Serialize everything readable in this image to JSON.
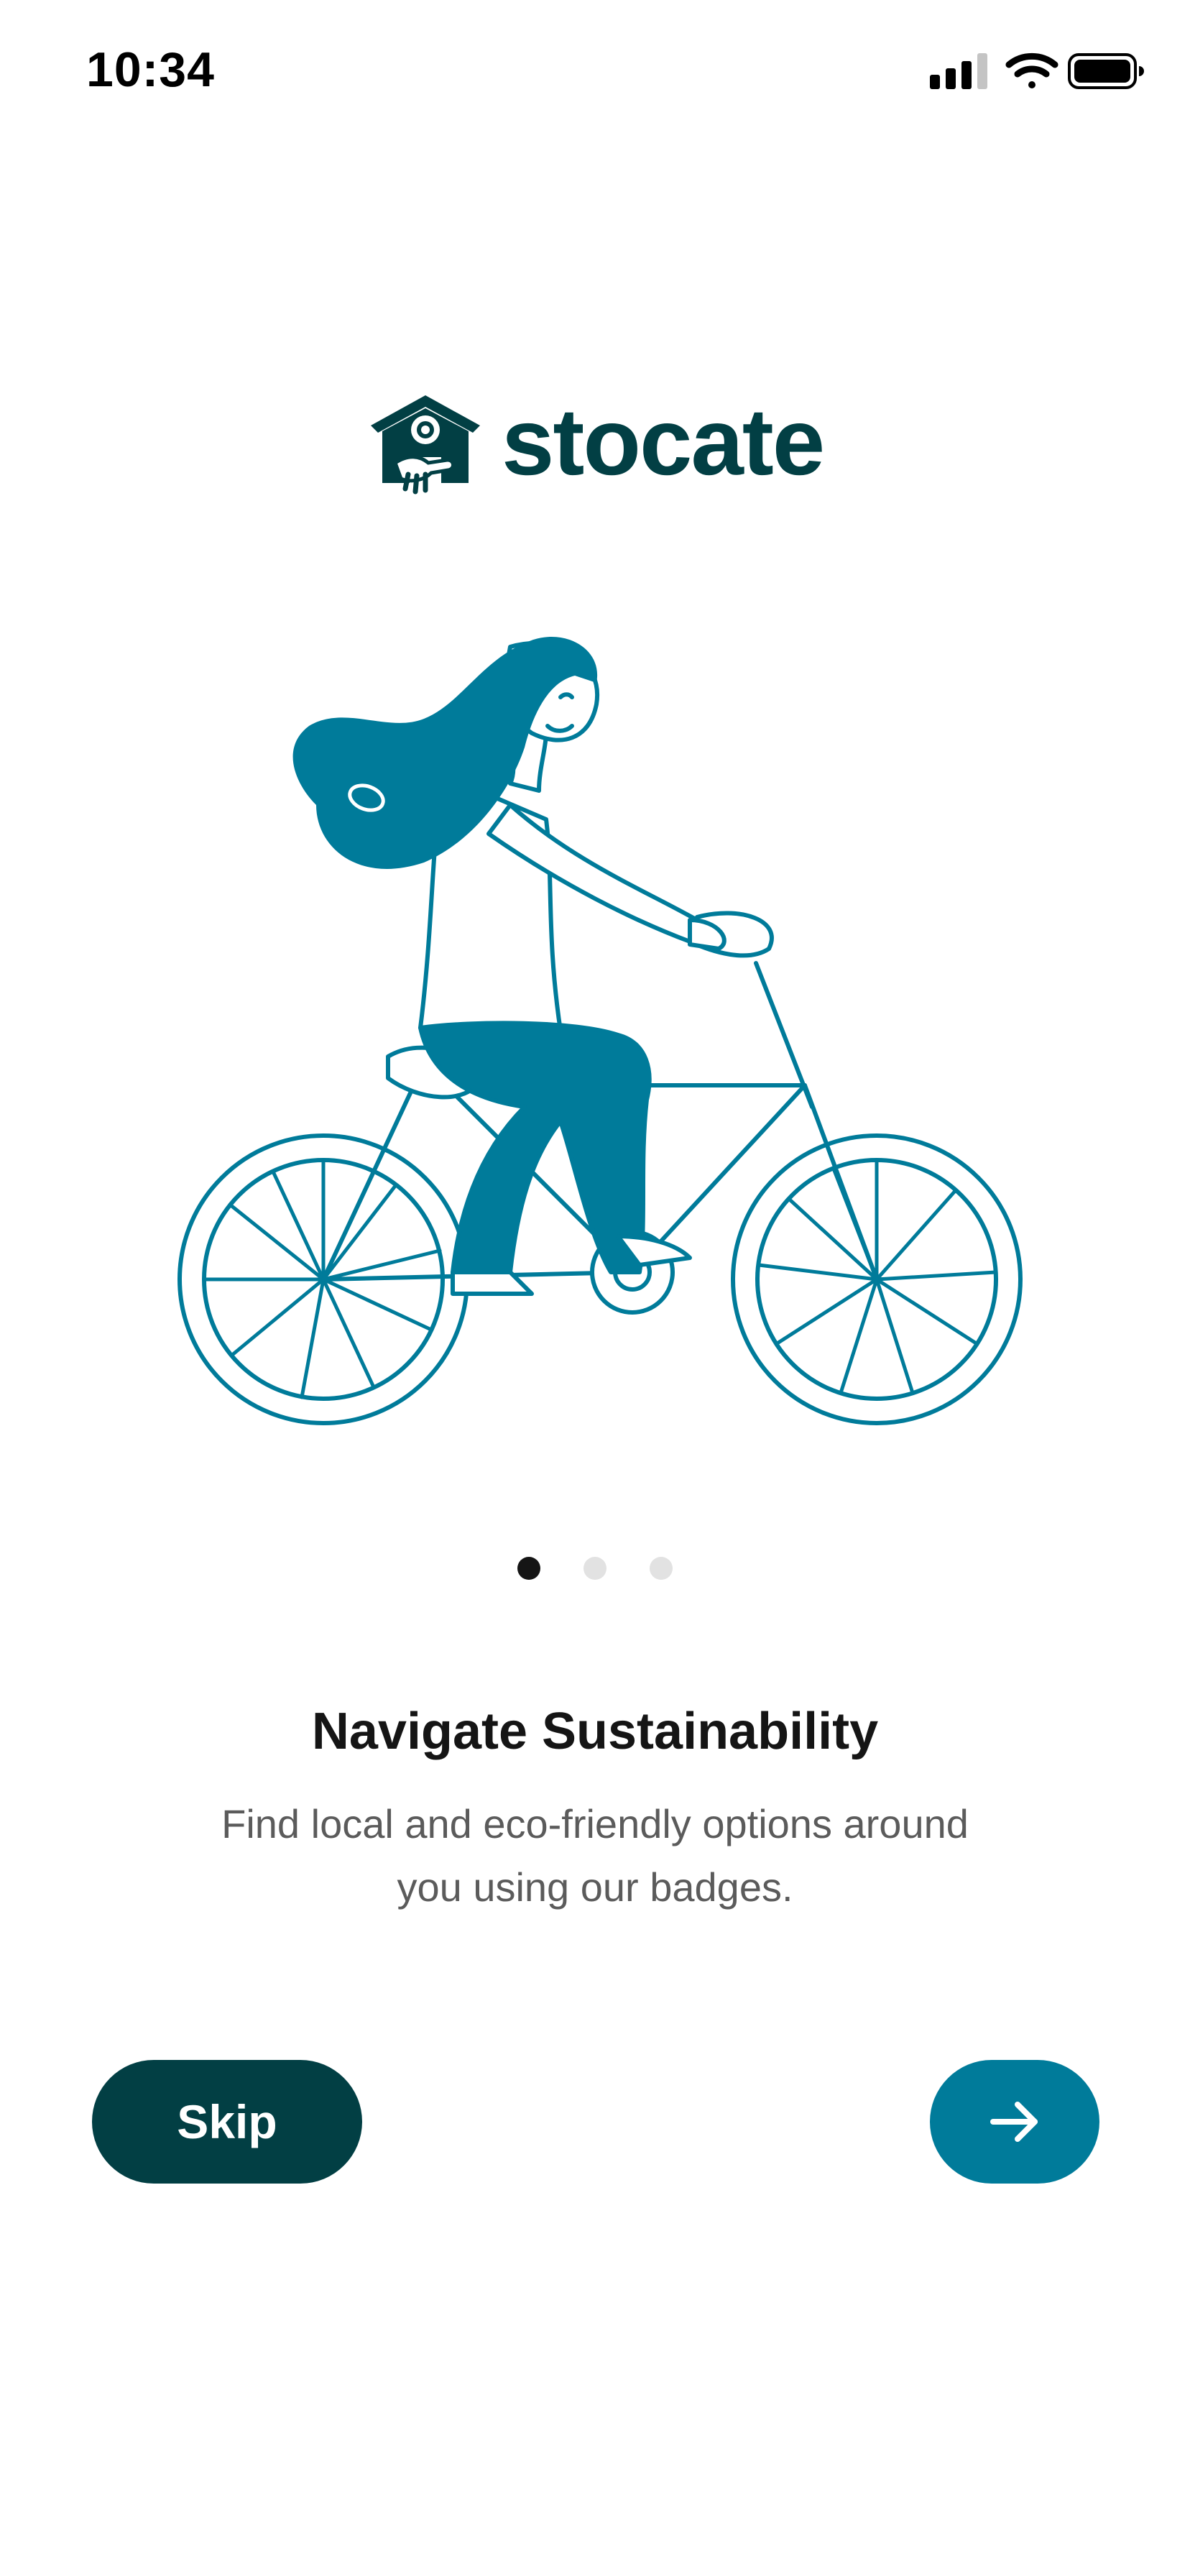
{
  "status_bar": {
    "time": "10:34",
    "icons": [
      "cellular-signal-icon",
      "wifi-icon",
      "battery-icon"
    ]
  },
  "logo": {
    "text": "stocate",
    "icon": "house-handshake-icon"
  },
  "illustration": {
    "subject": "woman-riding-bicycle-illustration"
  },
  "pagination": {
    "total": 3,
    "active_index": 0
  },
  "onboarding": {
    "headline": "Navigate Sustainability",
    "description": "Find local and eco-friendly options around you using our badges."
  },
  "actions": {
    "skip_label": "Skip",
    "next_icon": "arrow-right-icon"
  },
  "colors": {
    "brand_dark": "#023f44",
    "brand_accent": "#007b9a",
    "dot_active": "#151515",
    "dot_inactive": "#e2e2e2",
    "text_primary": "#151515",
    "text_secondary": "#5b5b5b"
  }
}
